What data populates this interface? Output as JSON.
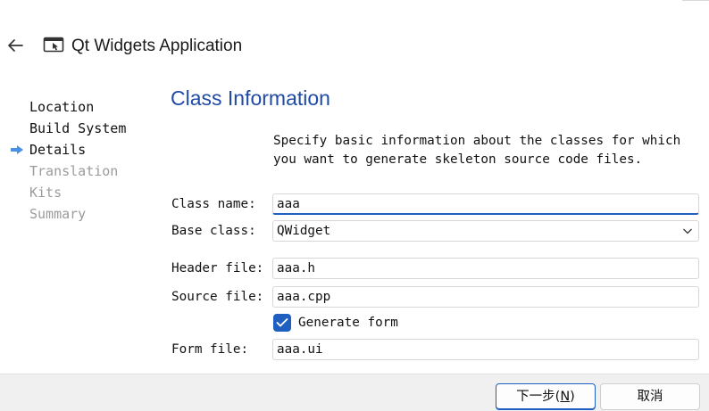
{
  "window": {
    "title": "Qt Widgets Application",
    "back_icon": "back-arrow-icon",
    "app_icon": "app-window-icon"
  },
  "sidebar": {
    "current_indicator_icon": "current-step-arrow-icon",
    "items": [
      {
        "label": "Location",
        "state": "done"
      },
      {
        "label": "Build System",
        "state": "done"
      },
      {
        "label": "Details",
        "state": "current"
      },
      {
        "label": "Translation",
        "state": "disabled"
      },
      {
        "label": "Kits",
        "state": "disabled"
      },
      {
        "label": "Summary",
        "state": "disabled"
      }
    ]
  },
  "page": {
    "title": "Class Information",
    "description": "Specify basic information about the classes for which you want to generate skeleton source code files."
  },
  "form": {
    "class_name": {
      "label": "Class name:",
      "value": "aaa"
    },
    "base_class": {
      "label": "Base class:",
      "value": "QWidget"
    },
    "header_file": {
      "label": "Header file:",
      "value": "aaa.h"
    },
    "source_file": {
      "label": "Source file:",
      "value": "aaa.cpp"
    },
    "generate_form": {
      "label": "Generate form",
      "checked": true
    },
    "form_file": {
      "label": "Form file:",
      "value": "aaa.ui"
    }
  },
  "footer": {
    "next_label": "下一步(N)",
    "next_mnemonic": "N",
    "cancel_label": "取消"
  },
  "colors": {
    "accent": "#1f5fbf",
    "title_blue": "#1f4aa6",
    "disabled_text": "#9b9b9b",
    "sidebar_arrow": "#4a90e2",
    "footer_bg": "#f0f0f0"
  }
}
